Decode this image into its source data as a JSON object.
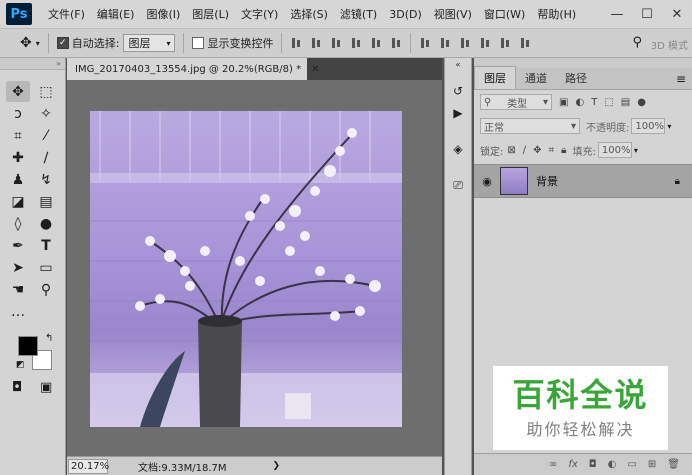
{
  "app": {
    "logo": "Ps"
  },
  "menu": [
    "文件(F)",
    "编辑(E)",
    "图像(I)",
    "图层(L)",
    "文字(Y)",
    "选择(S)",
    "滤镜(T)",
    "3D(D)",
    "视图(V)",
    "窗口(W)",
    "帮助(H)"
  ],
  "window_controls": {
    "minimize": "—",
    "maximize": "☐",
    "close": "✕"
  },
  "options": {
    "auto_select_label": "自动选择:",
    "auto_select_checked": true,
    "auto_select_target": "图层",
    "show_transform_label": "显示变换控件",
    "mode_3d": "3D 模式"
  },
  "document": {
    "tab_title": "IMG_20170403_13554.jpg @ 20.2%(RGB/8) *",
    "zoom": "20.17%",
    "doc_info": "文档:9.33M/18.7M"
  },
  "colors": {
    "foreground": "#000000",
    "background": "#ffffff"
  },
  "layers_panel": {
    "tabs": [
      "图层",
      "通道",
      "路径"
    ],
    "filter_kind": "类型",
    "blend_mode": "正常",
    "opacity_label": "不透明度:",
    "opacity_value": "100%",
    "lock_label": "锁定:",
    "fill_label": "填充:",
    "fill_value": "100%",
    "layers": [
      {
        "name": "背景",
        "locked": true,
        "visible": true
      }
    ]
  },
  "watermark": {
    "title": "百科全说",
    "subtitle": "助你轻松解决"
  }
}
